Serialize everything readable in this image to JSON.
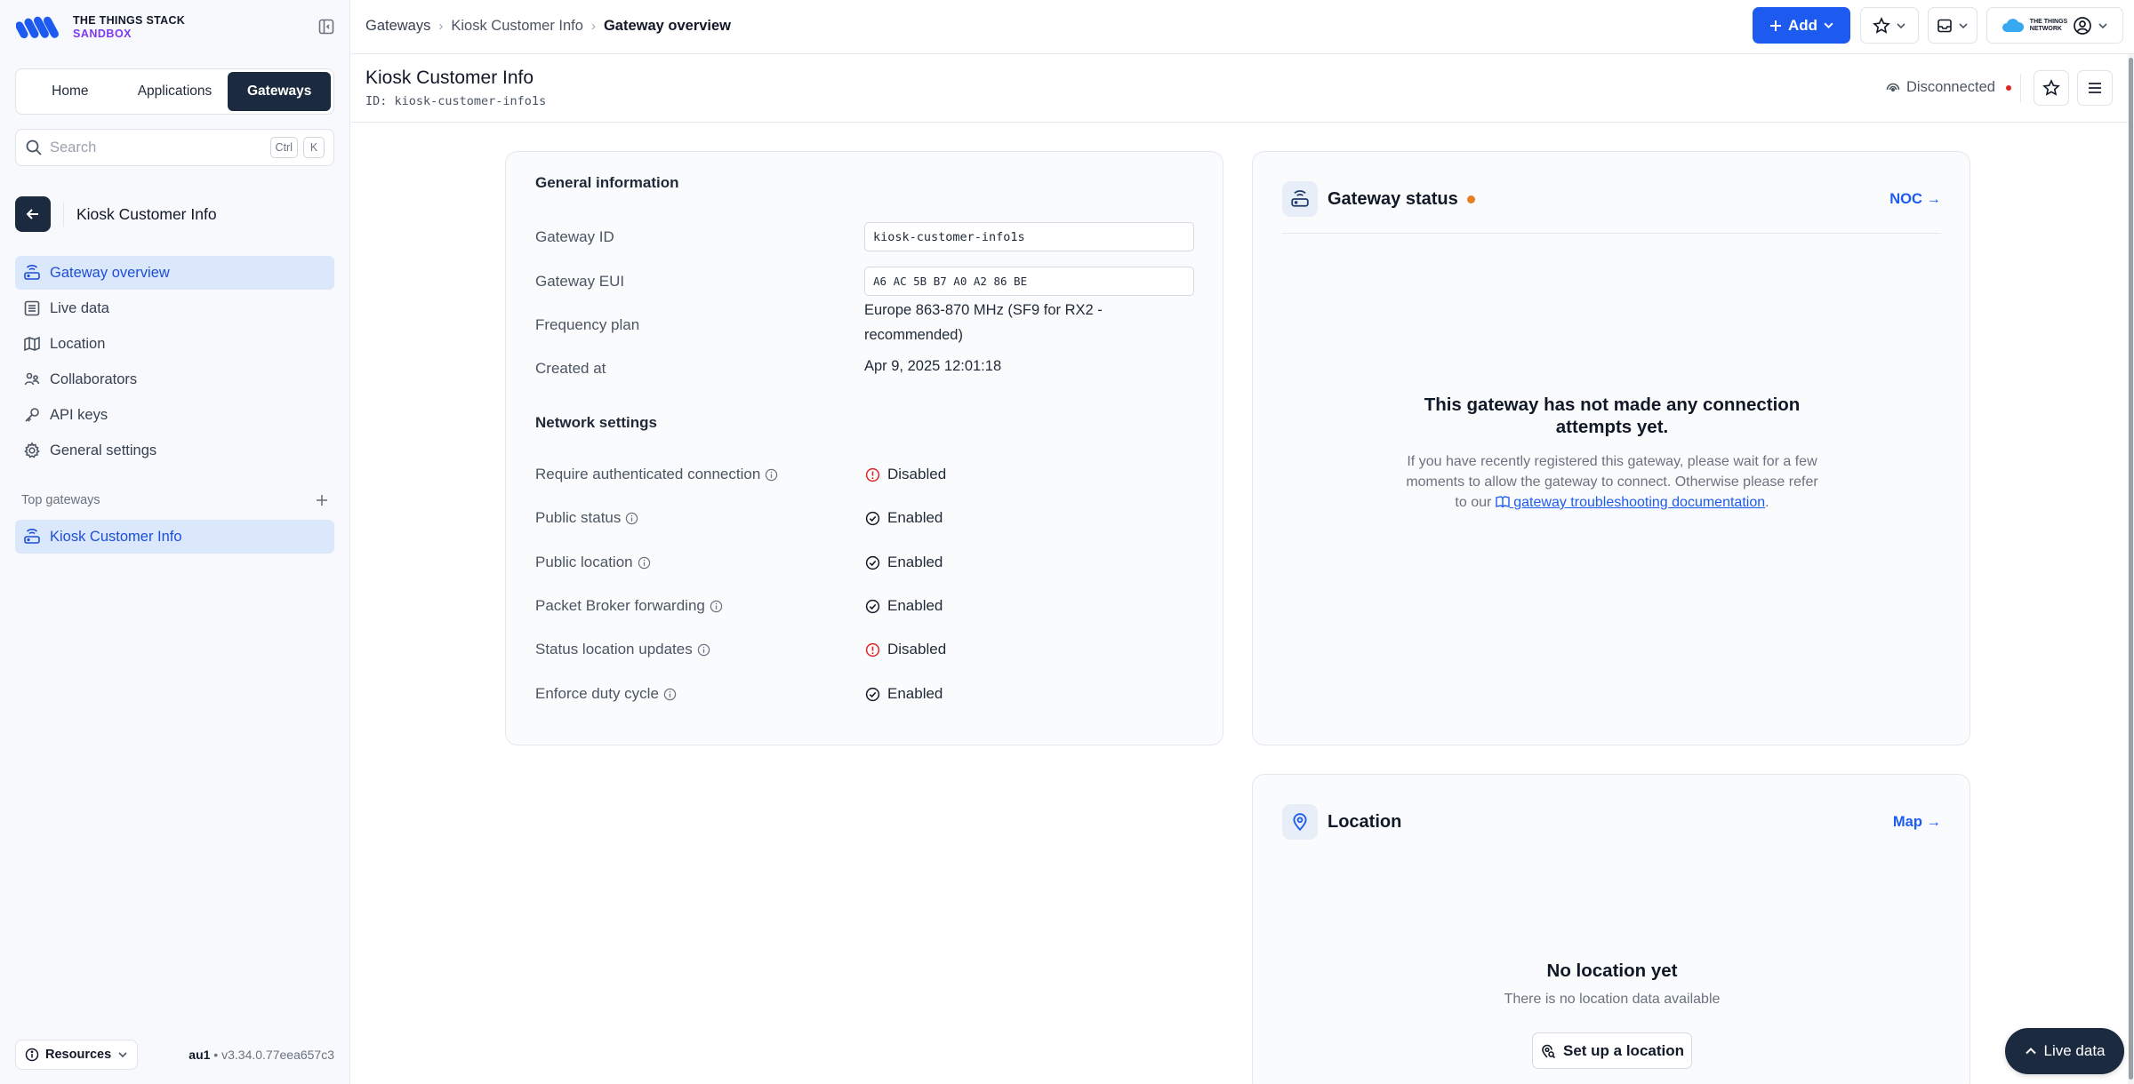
{
  "brand": {
    "line1": "THE THINGS STACK",
    "line2": "SANDBOX",
    "tti_label_1": "THE THINGS",
    "tti_label_2": "NETWORK"
  },
  "switcher": {
    "items": [
      "Home",
      "Applications",
      "Gateways"
    ],
    "active": "Gateways"
  },
  "search": {
    "placeholder": "Search",
    "kbd1": "Ctrl",
    "kbd2": "K"
  },
  "entity": {
    "title": "Kiosk Customer Info"
  },
  "nav": {
    "items": [
      {
        "label": "Gateway overview",
        "icon": "router-icon",
        "active": true
      },
      {
        "label": "Live data",
        "icon": "list-icon"
      },
      {
        "label": "Location",
        "icon": "map-icon"
      },
      {
        "label": "Collaborators",
        "icon": "users-icon"
      },
      {
        "label": "API keys",
        "icon": "key-icon"
      },
      {
        "label": "General settings",
        "icon": "gear-icon"
      }
    ]
  },
  "top_gateways": {
    "heading": "Top gateways",
    "items": [
      "Kiosk Customer Info"
    ]
  },
  "footer": {
    "resources": "Resources",
    "cluster": "au1",
    "version": "v3.34.0.77eea657c3"
  },
  "breadcrumb": [
    "Gateways",
    "Kiosk Customer Info",
    "Gateway overview"
  ],
  "toolbar": {
    "add": "Add"
  },
  "page": {
    "title": "Kiosk Customer Info",
    "id": "ID: kiosk-customer-info1s",
    "connection": "Disconnected"
  },
  "general": {
    "title": "General information",
    "gateway_id_label": "Gateway ID",
    "gateway_id": "kiosk-customer-info1s",
    "gateway_eui_label": "Gateway EUI",
    "gateway_eui": "A6 AC 5B B7 A0 A2 86 BE",
    "frequency_label": "Frequency plan",
    "frequency_line1": "Europe 863-870 MHz (SF9 for RX2 -",
    "frequency_line2": "recommended)",
    "created_label": "Created at",
    "created": "Apr 9, 2025 12:01:18"
  },
  "network": {
    "title": "Network settings",
    "rows": [
      {
        "label": "Require authenticated connection",
        "value": "Disabled",
        "state": "disabled"
      },
      {
        "label": "Public status",
        "value": "Enabled",
        "state": "enabled"
      },
      {
        "label": "Public location",
        "value": "Enabled",
        "state": "enabled"
      },
      {
        "label": "Packet Broker forwarding",
        "value": "Enabled",
        "state": "enabled"
      },
      {
        "label": "Status location updates",
        "value": "Disabled",
        "state": "disabled"
      },
      {
        "label": "Enforce duty cycle",
        "value": "Enabled",
        "state": "enabled"
      }
    ]
  },
  "gateway_status": {
    "title": "Gateway status",
    "link": "NOC →",
    "empty_title": "This gateway has not made any connection attempts yet.",
    "empty_text": "If you have recently registered this gateway, please wait for a few moments to allow the gateway to connect. Otherwise please refer to our",
    "doc_link": "gateway troubleshooting documentation",
    "tail": "."
  },
  "location": {
    "title": "Location",
    "link": "Map →",
    "empty_title": "No location yet",
    "empty_text": "There is no location data available",
    "button": "Set up a location"
  },
  "live_data_button": "Live data",
  "colors": {
    "accent": "#1d5bf0",
    "dark": "#1c2a3f",
    "active_nav_bg": "#dbe8fb",
    "error": "#dc2626",
    "warning_dot": "#e67e22"
  }
}
